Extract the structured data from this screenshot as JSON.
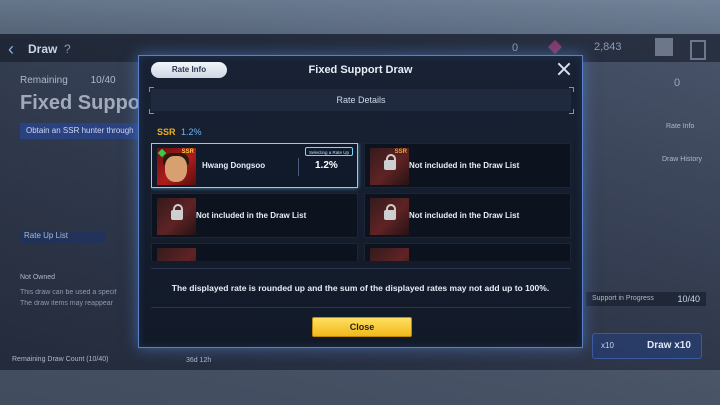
{
  "background": {
    "header_title": "Draw",
    "currency_1": "0",
    "currency_2": "2,843",
    "remaining_label": "Remaining",
    "remaining_value": "10/40",
    "banner_title": "Fixed Suppor",
    "obtain_text": "Obtain an SSR hunter through",
    "rate_up_list_label": "Rate Up List",
    "not_owned_label": "Not Owned",
    "can_be_used_text": "This draw can be used a specif",
    "reappear_text": "The draw items may reappear",
    "remaining_draw_count": "Remaining Draw Count (10/40)",
    "timer": "36d 12h",
    "side_counter": "0",
    "side_rate_info": "Rate Info",
    "side_draw_history": "Draw History",
    "progress_label": "Support in Progress",
    "progress_value": "10/40",
    "draw_x10_count": "x10",
    "draw_x10_label": "Draw x10"
  },
  "modal": {
    "rate_info_button": "Rate Info",
    "title": "Fixed Support Draw",
    "section_title": "Rate Details",
    "tier": {
      "label": "SSR",
      "rate": "1.2%"
    },
    "cards": [
      {
        "name": "Hwang Dongsoo",
        "tag": "Selecting a Rate Up",
        "rate": "1.2%",
        "selected": true
      },
      {
        "name": "Not included in the Draw List"
      },
      {
        "name": "Not included in the Draw List"
      },
      {
        "name": "Not included in the Draw List"
      }
    ],
    "disclaimer": "The displayed rate is rounded up and the sum of the displayed rates may not add up to 100%.",
    "close_button": "Close"
  },
  "colors": {
    "accent_gold": "#f0b020",
    "rate_blue": "#6cb4ff",
    "selection_cyan": "#7fd4ff",
    "close_button_yellow": "#ffd34a"
  }
}
